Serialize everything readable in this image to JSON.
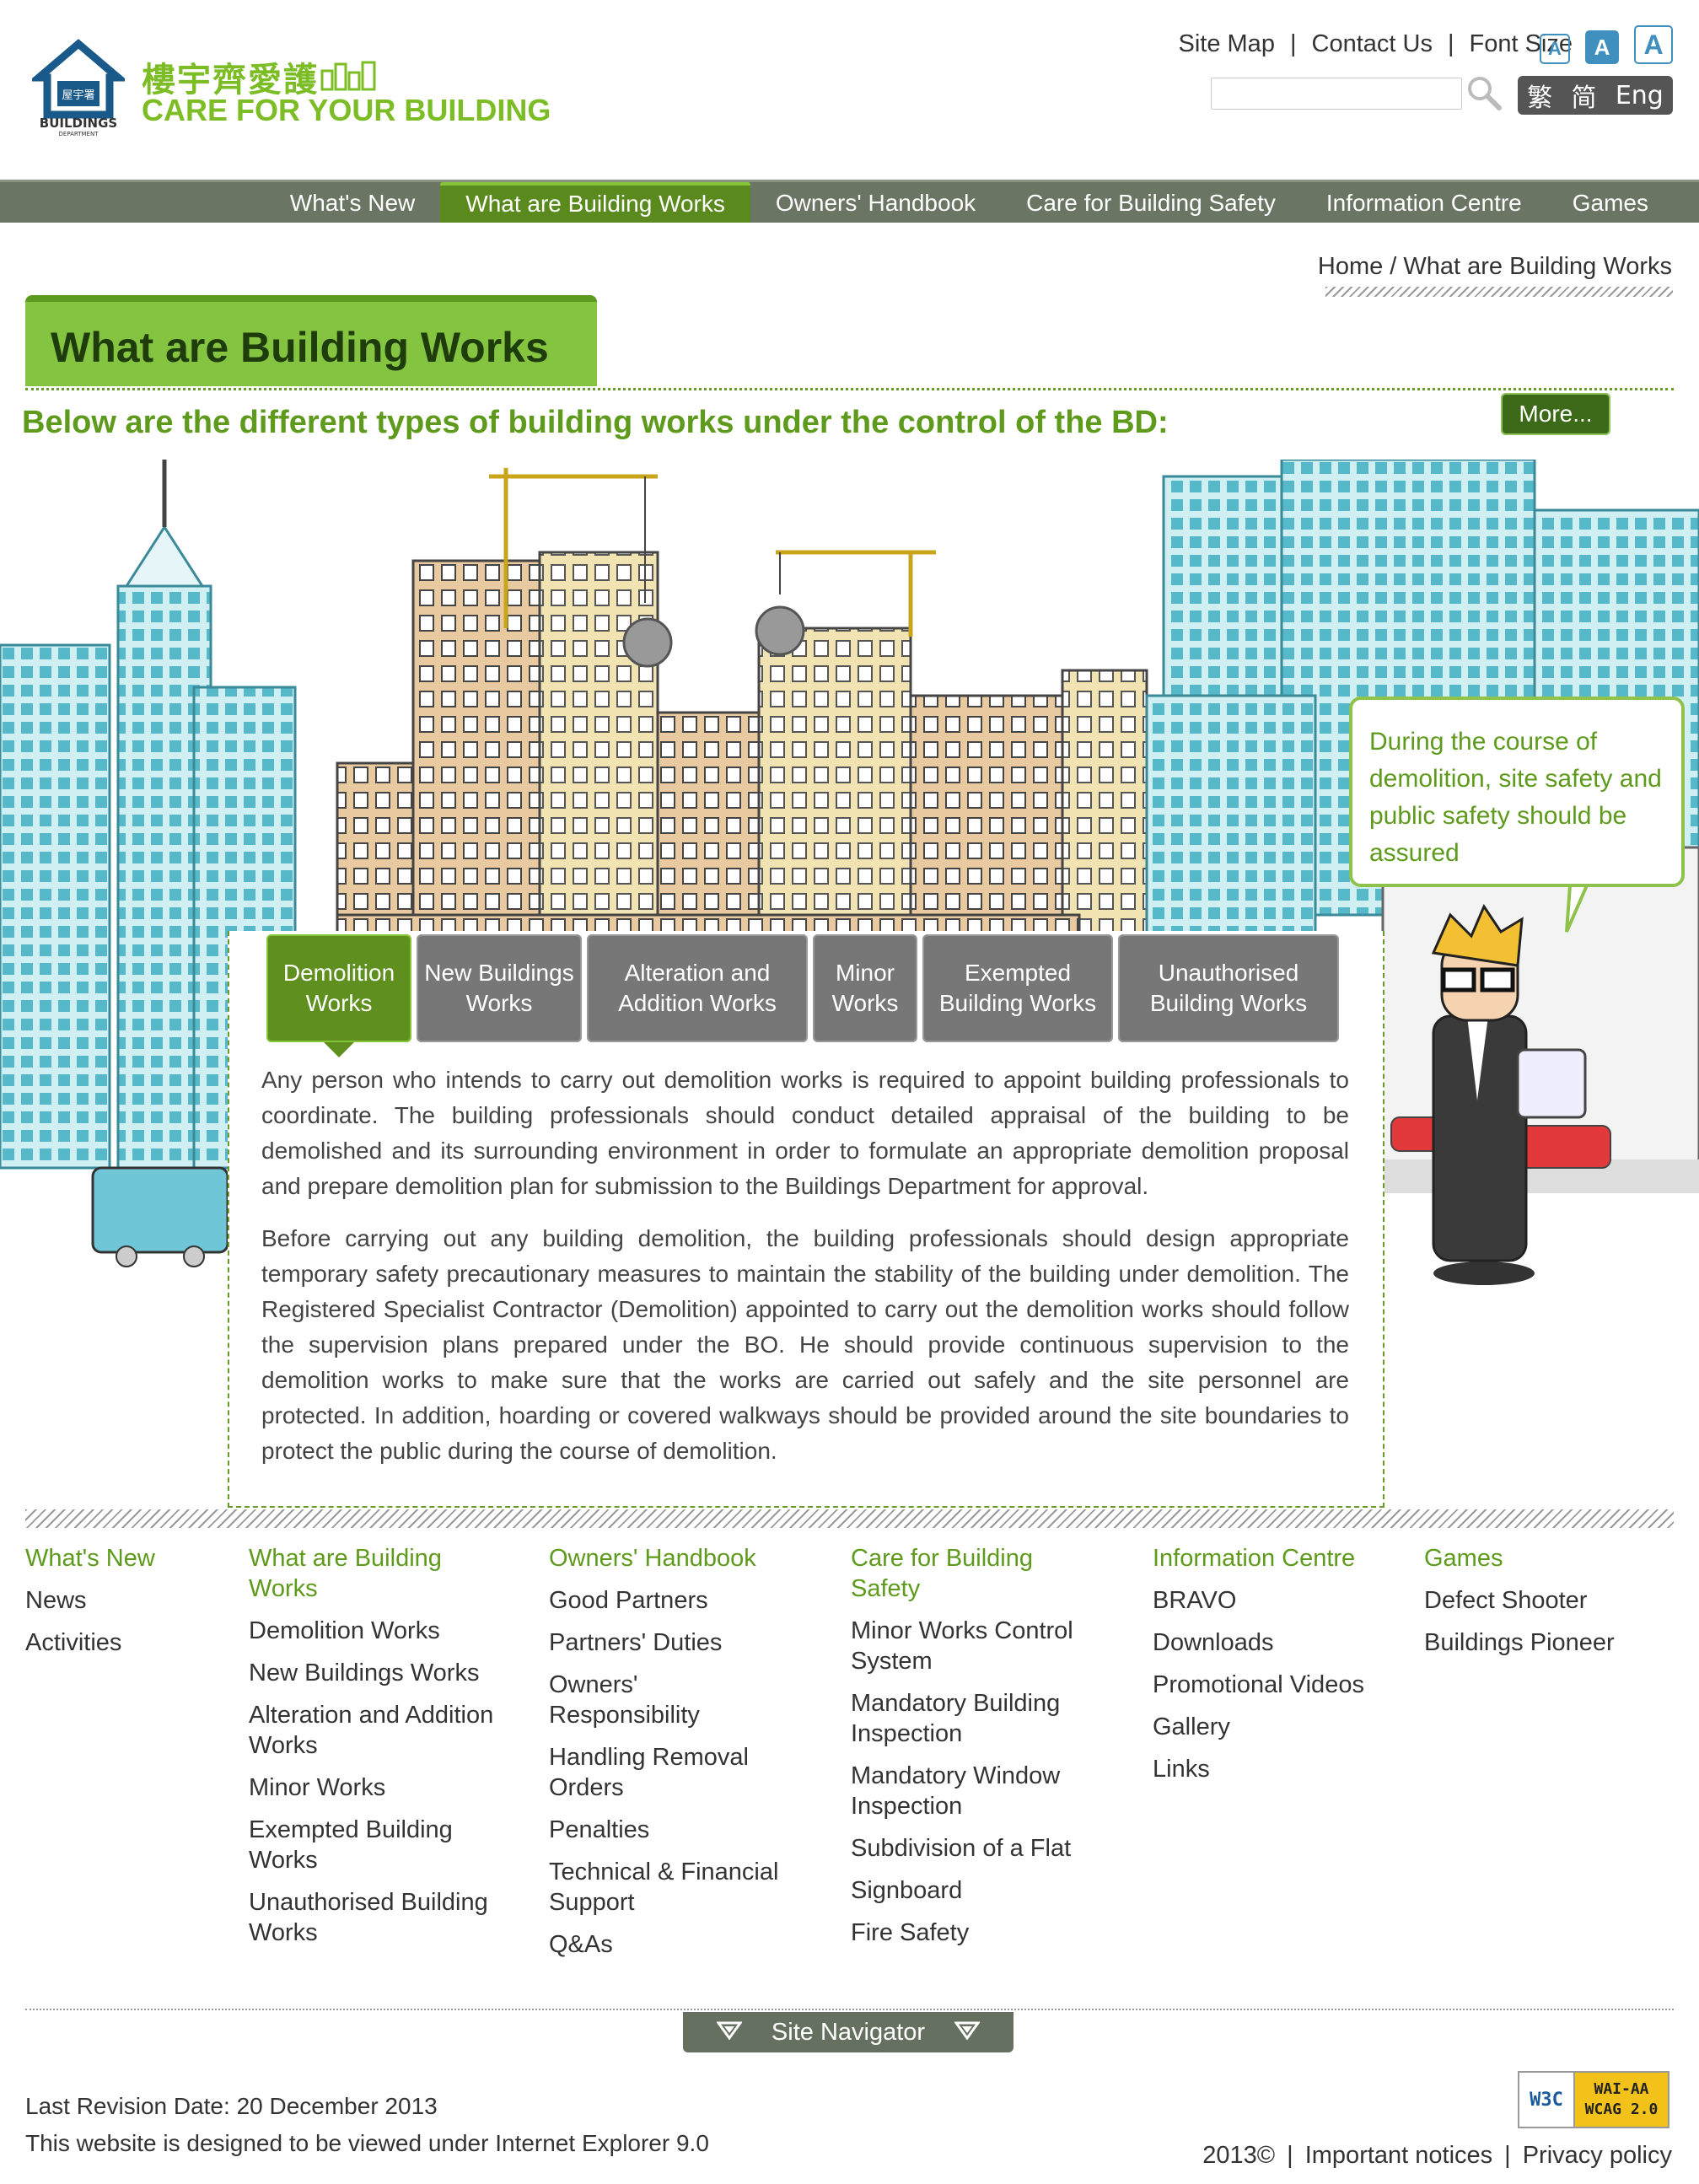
{
  "header": {
    "logo_cn": "樓宇齊愛護",
    "logo_en": "CARE FOR YOUR BUILDING",
    "dept_name": "BUILDINGS DEPARTMENT",
    "dept_cn": "屋宇署",
    "site_map": "Site Map",
    "contact_us": "Contact Us",
    "font_size_label": "Font Size",
    "font_buttons": [
      "A",
      "A",
      "A"
    ],
    "search_placeholder": "",
    "languages": [
      "繁",
      "简",
      "Eng"
    ]
  },
  "nav": {
    "items": [
      "What's New",
      "What are Building Works",
      "Owners' Handbook",
      "Care for Building Safety",
      "Information Centre",
      "Games"
    ],
    "active": "What are Building Works"
  },
  "breadcrumb": "Home / What are Building Works",
  "page": {
    "title": "What are Building Works",
    "subtitle": "Below are the different types of building works under the control of the BD:",
    "more": "More..."
  },
  "bubble": "During the course of demolition, site safety and public safety should be assured",
  "tabs": [
    {
      "label": "Demolition Works"
    },
    {
      "label": "New Buildings Works"
    },
    {
      "label": "Alteration and Addition Works"
    },
    {
      "label": "Minor Works"
    },
    {
      "label": "Exempted Building Works"
    },
    {
      "label": "Unauthorised Building Works"
    }
  ],
  "content": {
    "para1": "Any person who intends to carry out demolition works is required to appoint building professionals to coordinate. The building professionals should conduct detailed appraisal of the building to be demolished and its surrounding environment in order to formulate an appropriate demolition proposal and prepare demolition plan for submission to the Buildings Department for approval.",
    "para2": "Before carrying out any building demolition, the building professionals should design appropriate temporary safety precautionary measures to maintain the stability of the building under demolition. The Registered Specialist Contractor (Demolition) appointed to carry out the demolition works should follow the supervision plans prepared under the BO. He should provide continuous supervision to the demolition works to make sure that the works are carried out safely and the site personnel are protected. In addition, hoarding or covered walkways should be provided around the site boundaries to protect the public during the course of demolition."
  },
  "footer": {
    "columns": [
      {
        "heading": "What's New",
        "items": [
          "News",
          "Activities"
        ]
      },
      {
        "heading": "What are Building Works",
        "items": [
          "Demolition Works",
          "New Buildings Works",
          "Alteration and Addition Works",
          "Minor Works",
          "Exempted Building Works",
          "Unauthorised Building Works"
        ]
      },
      {
        "heading": "Owners' Handbook",
        "items": [
          "Good Partners",
          "Partners' Duties",
          "Owners' Responsibility",
          "Handling Removal Orders",
          "Penalties",
          "Technical & Financial Support",
          "Q&As"
        ]
      },
      {
        "heading": "Care for Building Safety",
        "items": [
          "Minor Works Control System",
          "Mandatory Building Inspection",
          "Mandatory Window Inspection",
          "Subdivision of a Flat",
          "Signboard",
          "Fire Safety"
        ]
      },
      {
        "heading": "Information Centre",
        "items": [
          "BRAVO",
          "Downloads",
          "Promotional Videos",
          "Gallery",
          "Links"
        ]
      },
      {
        "heading": "Games",
        "items": [
          "Defect Shooter",
          "Buildings Pioneer"
        ]
      }
    ],
    "site_navigator": "Site Navigator",
    "revision": "Last Revision Date: 20 December 2013",
    "designed_for": "This website is designed to be viewed under Internet Explorer 9.0",
    "copyright": "2013©",
    "important_notices": "Important notices",
    "privacy_policy": "Privacy policy",
    "wcag_left": "W3C",
    "wcag_right_1": "WAI-AA",
    "wcag_right_2": "WCAG 2.0"
  }
}
